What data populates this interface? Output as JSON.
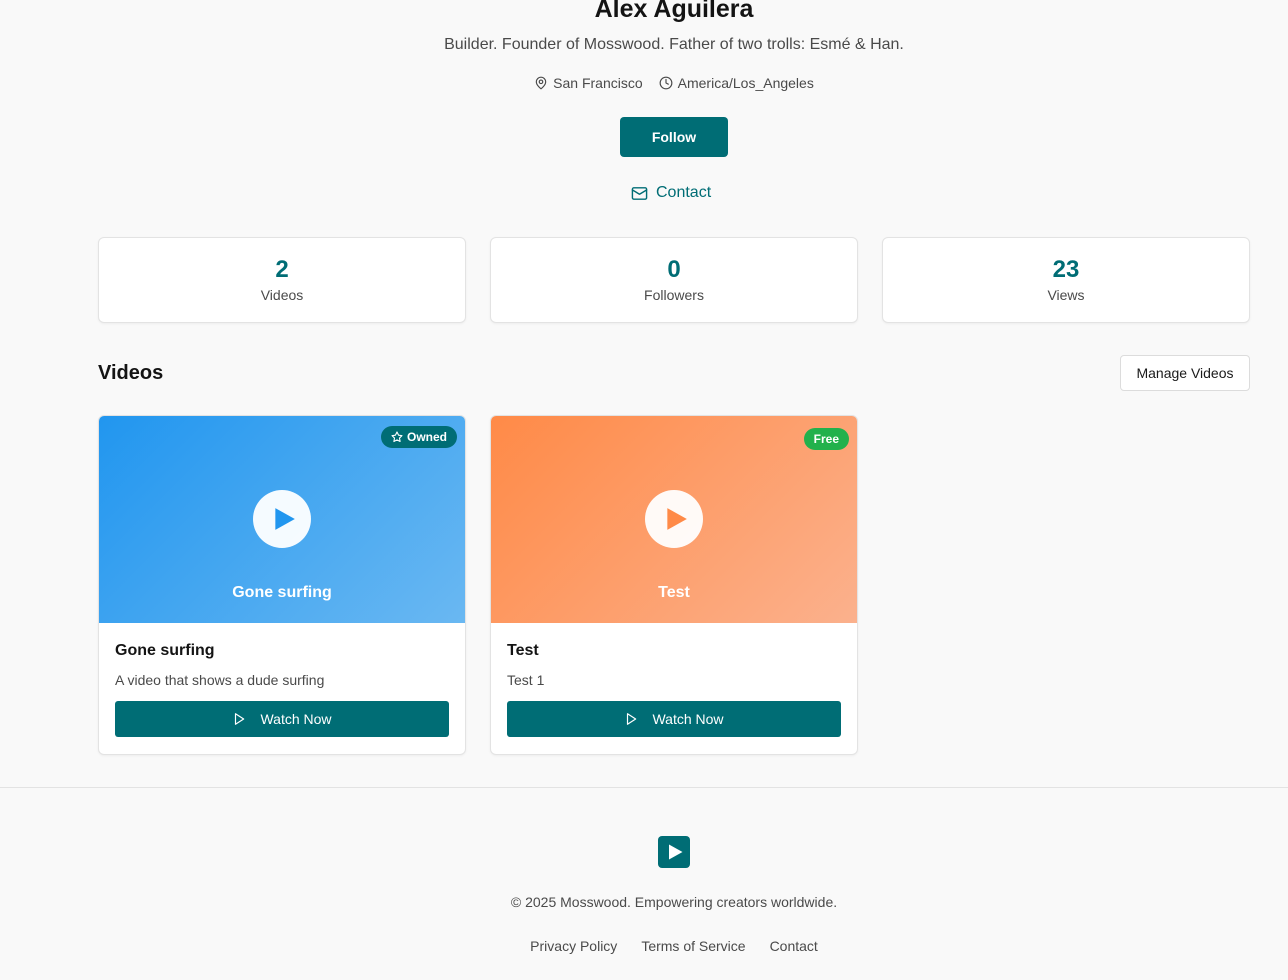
{
  "profile": {
    "name": "Alex Aguilera",
    "bio": "Builder. Founder of Mosswood. Father of two trolls: Esmé & Han.",
    "location": "San Francisco",
    "timezone": "America/Los_Angeles",
    "follow_label": "Follow",
    "contact_label": "Contact"
  },
  "stats": [
    {
      "value": "2",
      "label": "Videos"
    },
    {
      "value": "0",
      "label": "Followers"
    },
    {
      "value": "23",
      "label": "Views"
    }
  ],
  "videos_section": {
    "title": "Videos",
    "manage_label": "Manage Videos",
    "items": [
      {
        "thumb_title": "Gone surfing",
        "badge": "Owned",
        "title": "Gone surfing",
        "description": "A video that shows a dude surfing",
        "watch_label": "Watch Now"
      },
      {
        "thumb_title": "Test",
        "badge": "Free",
        "title": "Test",
        "description": "Test 1",
        "watch_label": "Watch Now"
      }
    ]
  },
  "footer": {
    "copyright": "© 2025 Mosswood. Empowering creators worldwide.",
    "links": [
      "Privacy Policy",
      "Terms of Service",
      "Contact"
    ]
  },
  "colors": {
    "accent": "#006d75",
    "free_badge": "#22b14c",
    "thumb_blue": "#2196ef",
    "thumb_orange": "#ff8a47"
  },
  "icons": [
    "map-pin-icon",
    "clock-icon",
    "mail-icon",
    "star-icon",
    "play-icon",
    "logo-icon"
  ]
}
